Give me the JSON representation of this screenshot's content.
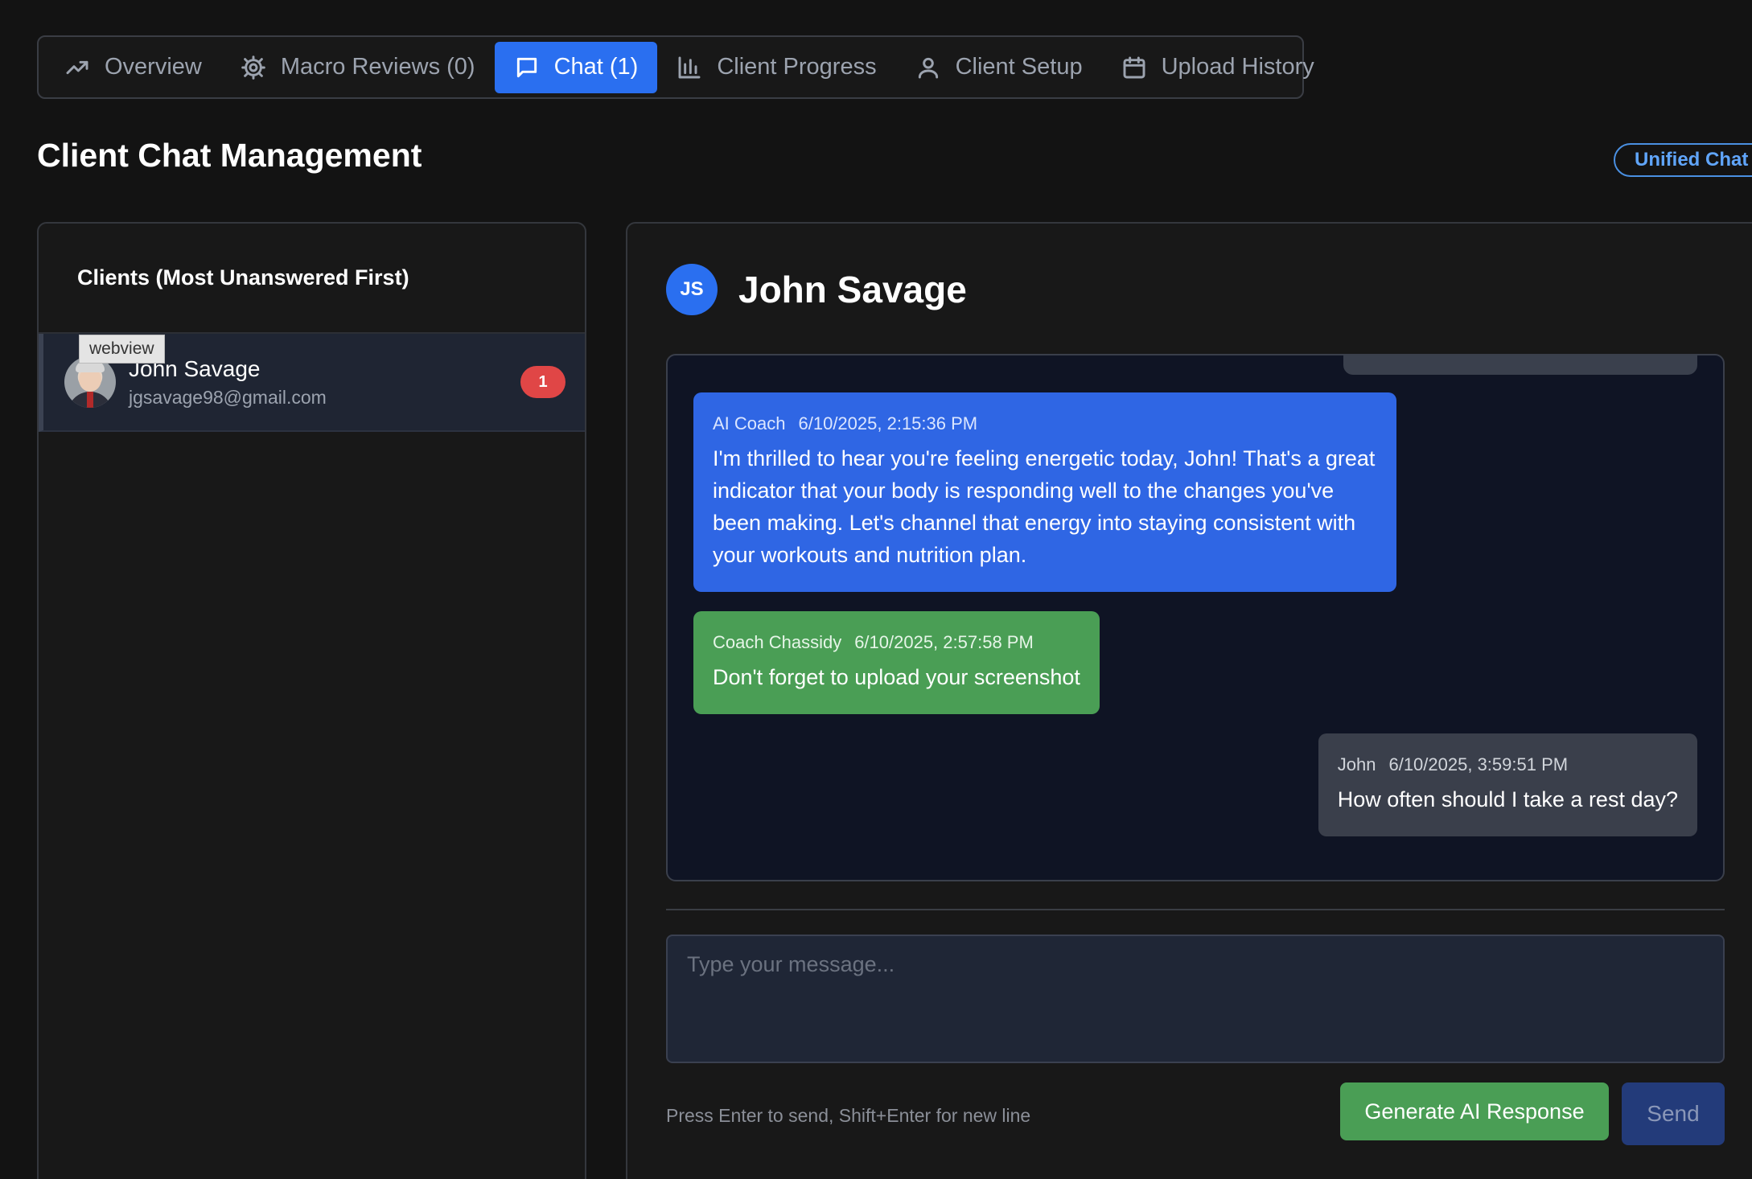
{
  "tabs": [
    {
      "label": "Overview",
      "icon": "trending-up-icon"
    },
    {
      "label": "Macro Reviews (0)",
      "icon": "gear-icon"
    },
    {
      "label": "Chat (1)",
      "icon": "chat-icon",
      "active": true
    },
    {
      "label": "Client Progress",
      "icon": "bar-chart-icon"
    },
    {
      "label": "Client Setup",
      "icon": "user-icon"
    },
    {
      "label": "Upload History",
      "icon": "calendar-icon"
    }
  ],
  "page": {
    "title": "Client Chat Management",
    "badge": "Unified Chat"
  },
  "client_list": {
    "header": "Clients (Most Unanswered First)",
    "tooltip": "webview",
    "clients": [
      {
        "name": "John Savage",
        "email": "jgsavage98@gmail.com",
        "unread": "1"
      }
    ]
  },
  "chat": {
    "avatar_initials": "JS",
    "title": "John Savage",
    "messages": [
      {
        "sender": "AI Coach",
        "timestamp": "6/10/2025, 2:15:36 PM",
        "text": "I'm thrilled to hear you're feeling energetic today, John! That's a great indicator that your body is responding well to the changes you've been making. Let's channel that energy into staying consistent with your workouts and nutrition plan."
      },
      {
        "sender": "Coach Chassidy",
        "timestamp": "6/10/2025, 2:57:58 PM",
        "text": "Don't forget to upload your screenshot"
      },
      {
        "sender": "John",
        "timestamp": "6/10/2025, 3:59:51 PM",
        "text": "How often should I take a rest day?"
      }
    ],
    "composer_placeholder": "Type your message...",
    "hint": "Press Enter to send, Shift+Enter for new line",
    "generate_label": "Generate AI Response",
    "send_label": "Send"
  },
  "colors": {
    "accent": "#2a6ff0",
    "ai_bubble": "#2f66e4",
    "coach_bubble": "#4a9e55",
    "client_bubble": "#3a3f4b",
    "unread_badge": "#e04646"
  }
}
